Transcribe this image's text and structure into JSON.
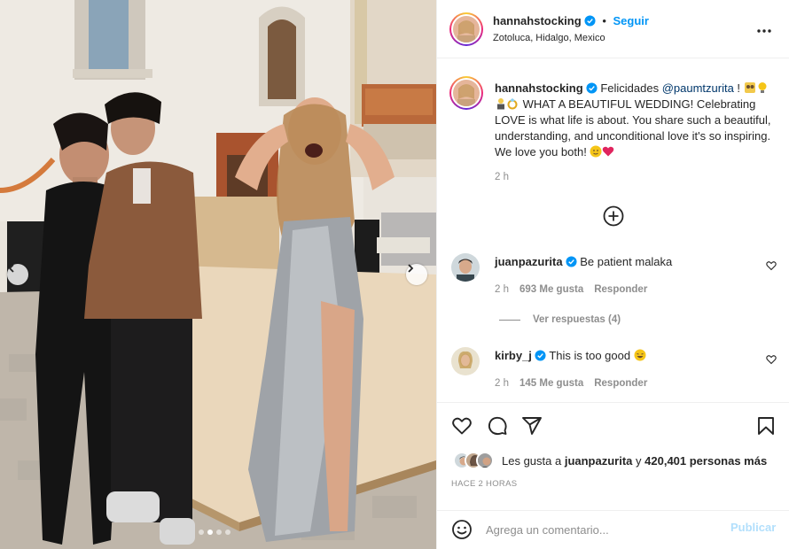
{
  "post": {
    "author": "hannahstocking",
    "follow_label": "Seguir",
    "separator": "•",
    "location": "Zotoluca, Hidalgo, Mexico",
    "more_label": "•••",
    "photo_alt": "wedding party photo carousel",
    "carousel": {
      "total": 4,
      "current": 1
    }
  },
  "caption": {
    "username": "hannahstocking",
    "text_1": "Felicidades ",
    "mention": "@paumtzurita",
    "text_2": " ! ",
    "text_3": " WHAT A BEAUTIFUL WEDDING! Celebrating LOVE is what life is about. You share such a beautiful, understanding, and unconditional love it's so inspiring. We love you both! ",
    "time": "2 h"
  },
  "comments": [
    {
      "username": "juanpazurita",
      "text": "Be patient malaka",
      "time": "2 h",
      "likes": "693 Me gusta",
      "reply_label": "Responder",
      "view_replies": "Ver respuestas (4)"
    },
    {
      "username": "kirby_j",
      "text": "This is too good ",
      "time": "2 h",
      "likes": "145 Me gusta",
      "reply_label": "Responder"
    }
  ],
  "likes": {
    "prefix": "Les gusta a ",
    "user": "juanpazurita",
    "middle": " y ",
    "others": "420,401 personas más"
  },
  "timestamp": "HACE 2 HORAS",
  "composer": {
    "placeholder": "Agrega un comentario...",
    "post_label": "Publicar"
  },
  "colors": {
    "accent": "#0095f6",
    "verified": "#0095f6",
    "post_disabled": "#b2dffc",
    "muted": "#8e8e8e"
  },
  "icons": [
    "verified-icon",
    "more-icon",
    "add-circle-icon",
    "heart-icon",
    "comment-icon",
    "share-icon",
    "bookmark-icon",
    "emoji-icon",
    "chevron-left-icon",
    "chevron-right-icon"
  ]
}
